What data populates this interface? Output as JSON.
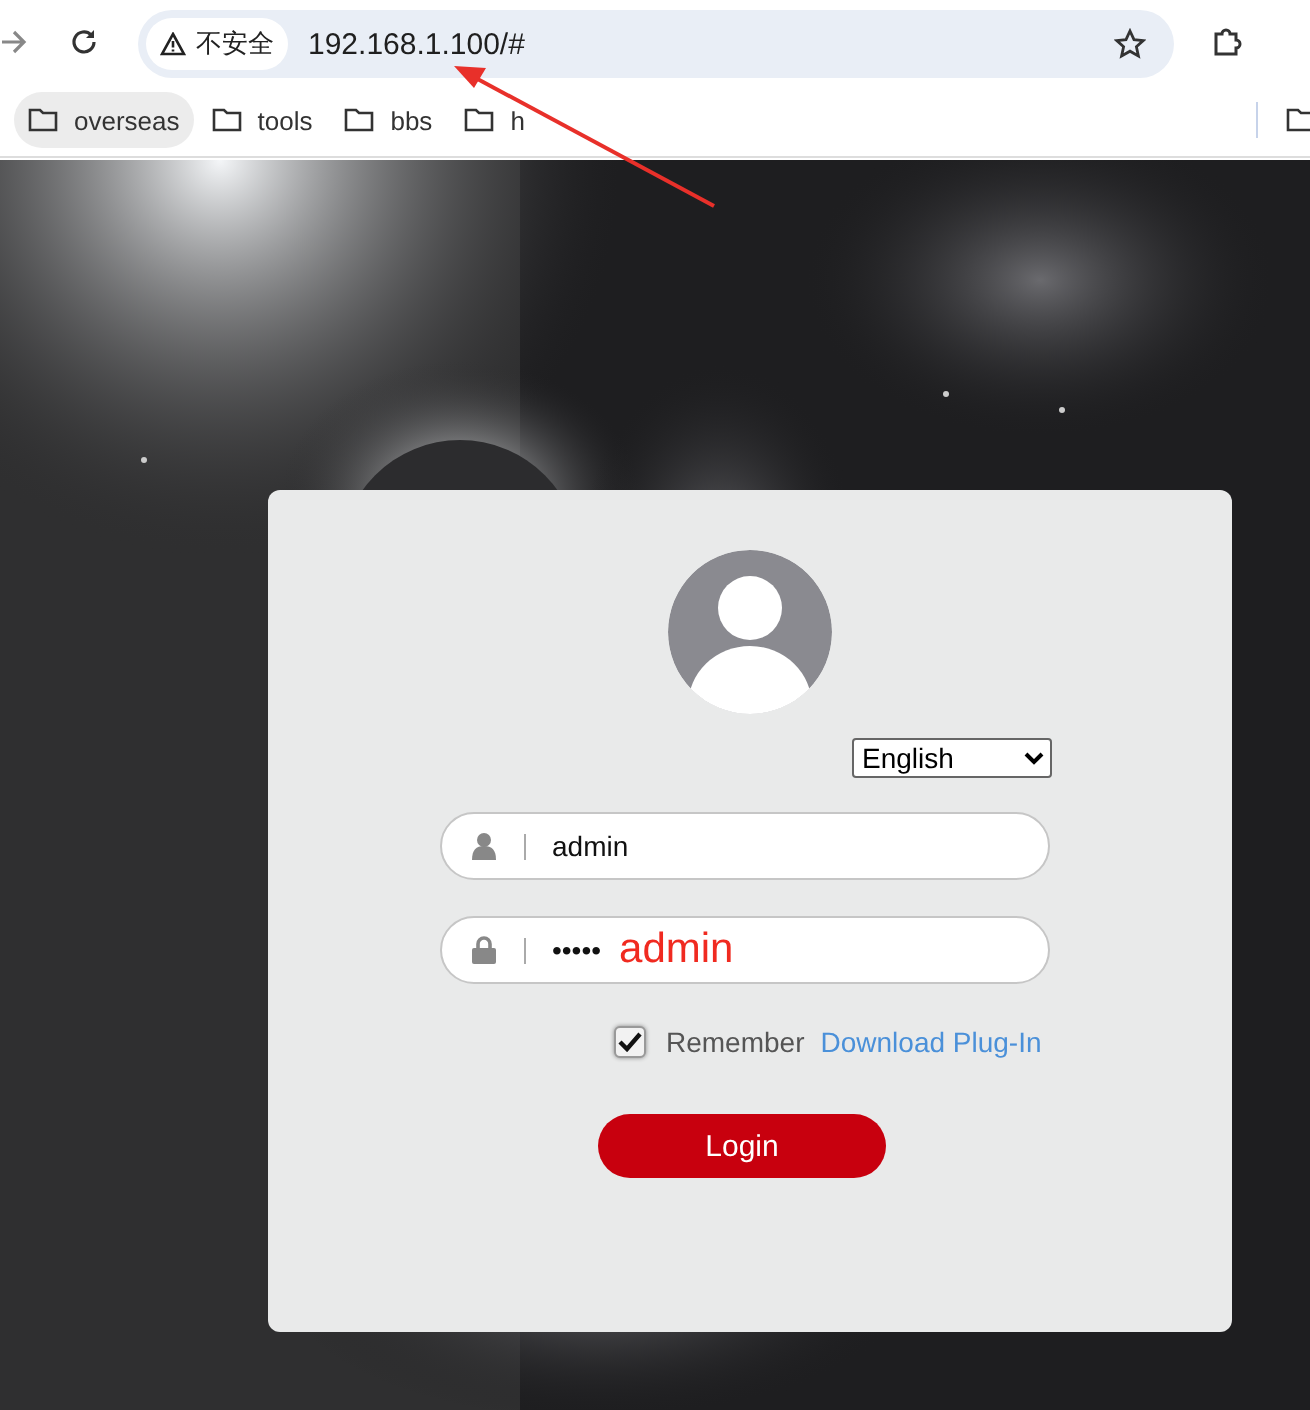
{
  "browser": {
    "security_label": "不安全",
    "url": "192.168.1.100/#",
    "bookmarks": [
      {
        "label": "overseas",
        "highlighted": true
      },
      {
        "label": "tools",
        "highlighted": false
      },
      {
        "label": "bbs",
        "highlighted": false
      },
      {
        "label": "h",
        "highlighted": false
      }
    ]
  },
  "login": {
    "language": "English",
    "username": "admin",
    "password": "•••••",
    "remember": {
      "label": "Remember",
      "checked": true
    },
    "download_link": "Download Plug-In",
    "login_button": "Login"
  },
  "annotations": [
    {
      "kind": "arrow"
    },
    {
      "kind": "text",
      "text": "admin"
    }
  ]
}
